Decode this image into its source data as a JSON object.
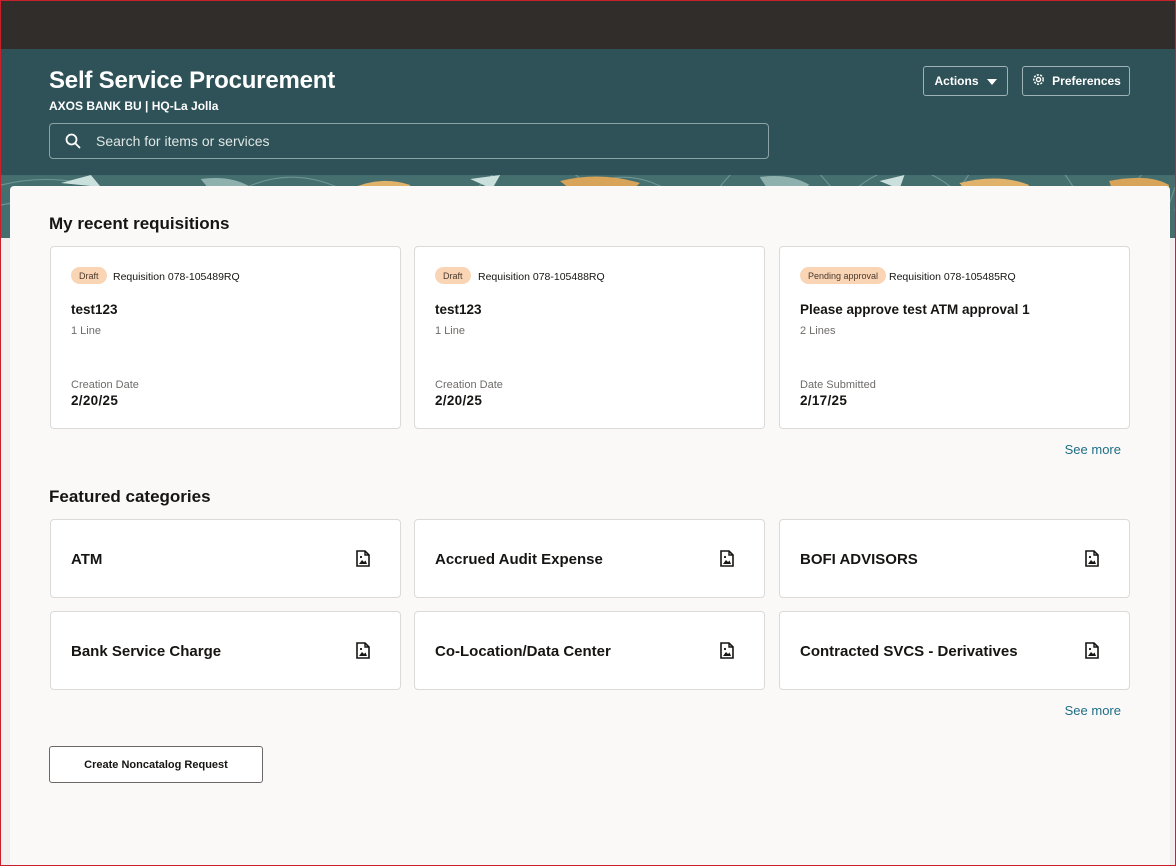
{
  "header": {
    "title": "Self Service Procurement",
    "subtitle": "AXOS BANK BU | HQ-La Jolla",
    "search_placeholder": "Search for items or services",
    "actions_label": "Actions",
    "preferences_label": "Preferences"
  },
  "recent": {
    "title": "My recent requisitions",
    "see_more": "See more",
    "items": [
      {
        "status": "Draft",
        "number": "Requisition 078-105489RQ",
        "title": "test123",
        "lines": "1 Line",
        "date_label": "Creation Date",
        "date": "2/20/25"
      },
      {
        "status": "Draft",
        "number": "Requisition 078-105488RQ",
        "title": "test123",
        "lines": "1 Line",
        "date_label": "Creation Date",
        "date": "2/20/25"
      },
      {
        "status": "Pending approval",
        "number": "Requisition 078-105485RQ",
        "title": "Please approve test ATM approval 1",
        "lines": "2 Lines",
        "date_label": "Date Submitted",
        "date": "2/17/25"
      }
    ]
  },
  "categories": {
    "title": "Featured categories",
    "see_more": "See more",
    "items": [
      {
        "label": "ATM",
        "icon": "image-file-icon"
      },
      {
        "label": "Accrued Audit Expense",
        "icon": "image-file-icon"
      },
      {
        "label": "BOFI ADVISORS",
        "icon": "image-file-icon"
      },
      {
        "label": "Bank Service Charge",
        "icon": "image-file-icon"
      },
      {
        "label": "Co-Location/Data Center",
        "icon": "image-file-icon"
      },
      {
        "label": "Contracted SVCS - Derivatives",
        "icon": "image-file-icon"
      }
    ]
  },
  "footer": {
    "create_button": "Create Noncatalog Request"
  },
  "colors": {
    "topbar": "#312d2a",
    "hero": "#2e5257",
    "badge": "#f9d5b5",
    "link": "#1f6d86"
  }
}
